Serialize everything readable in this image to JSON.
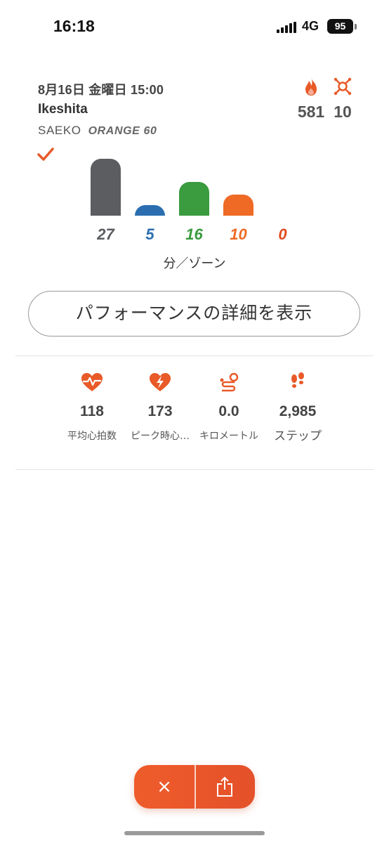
{
  "status_bar": {
    "time": "16:18",
    "network": "4G",
    "battery": "95"
  },
  "workout": {
    "date": "8月16日 金曜日 15:00",
    "location": "Ikeshita",
    "coach": "SAEKO",
    "class_name": "ORANGE 60",
    "calories": "581",
    "splat_points": "10"
  },
  "zones": {
    "unit_label": "分／ゾーン",
    "items": [
      {
        "value": 27,
        "label": "27",
        "color": "#5b5d61",
        "level": 0.99
      },
      {
        "value": 5,
        "label": "5",
        "color": "#2a6eb0",
        "level": 0.18
      },
      {
        "value": 16,
        "label": "16",
        "color": "#3a9b3f",
        "level": 0.59
      },
      {
        "value": 10,
        "label": "10",
        "color": "#ee6a25",
        "level": 0.37
      },
      {
        "value": 0,
        "label": "0",
        "color": "#e14a1f",
        "level": 0
      }
    ]
  },
  "performance_button": {
    "label": "パフォーマンスの詳細を表示"
  },
  "metrics": [
    {
      "icon": "heart-rate-icon",
      "value": "118",
      "label": "平均心拍数"
    },
    {
      "icon": "peak-heart-icon",
      "value": "173",
      "label": "ピーク時心…"
    },
    {
      "icon": "distance-icon",
      "value": "0.0",
      "label": "キロメートル"
    },
    {
      "icon": "steps-icon",
      "value": "2,985",
      "label": "ステップ"
    }
  ],
  "actions": {
    "close_label": "×"
  },
  "colors": {
    "accent": "#e85a28",
    "text": "#333333"
  }
}
